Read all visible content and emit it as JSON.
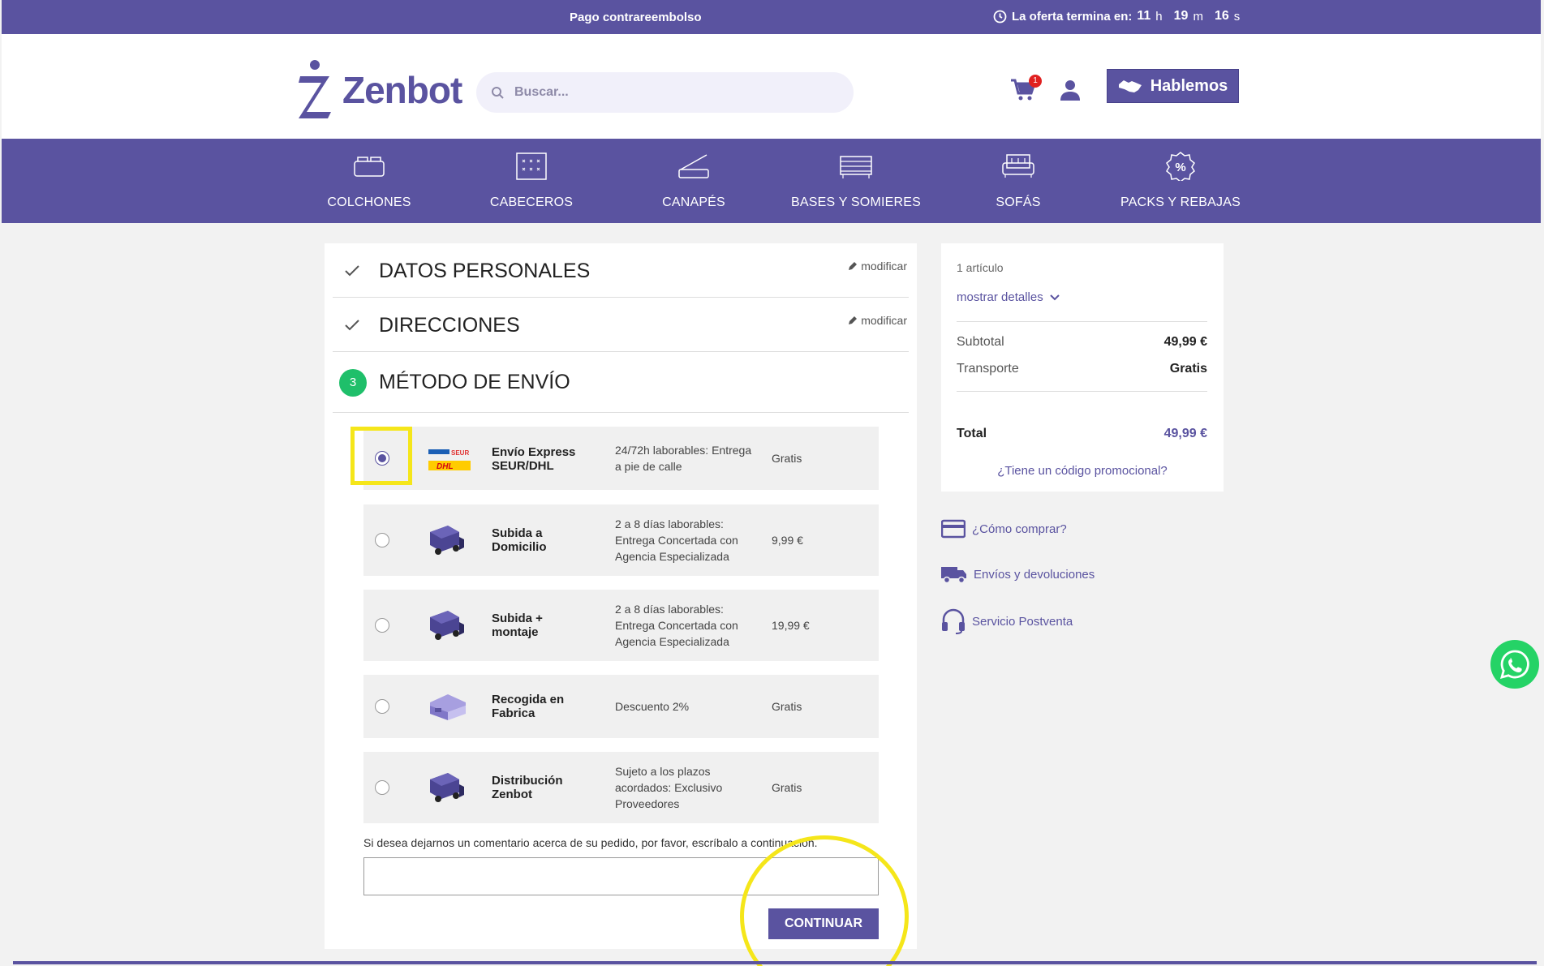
{
  "topbar": {
    "promo": "Pago contrareembolso",
    "offer_label": "La oferta termina en:",
    "hours": "11",
    "hours_unit": "h",
    "minutes": "19",
    "minutes_unit": "m",
    "seconds": "16",
    "seconds_unit": "s"
  },
  "header": {
    "logo_text": "Zenbot",
    "search_placeholder": "Buscar...",
    "cart_count": "1",
    "hablemos_label": "Hablemos"
  },
  "nav": [
    {
      "label": "COLCHONES",
      "icon": "mattress-icon"
    },
    {
      "label": "CABECEROS",
      "icon": "headboard-icon"
    },
    {
      "label": "CANAPÉS",
      "icon": "canape-icon"
    },
    {
      "label": "BASES Y SOMIERES",
      "icon": "bed-base-icon"
    },
    {
      "label": "SOFÁS",
      "icon": "sofa-icon"
    },
    {
      "label": "PACKS Y REBAJAS",
      "icon": "percent-badge-icon"
    }
  ],
  "steps": {
    "personal": {
      "title": "DATOS PERSONALES",
      "modify": "modificar"
    },
    "addresses": {
      "title": "DIRECCIONES",
      "modify": "modificar"
    },
    "shipping": {
      "number": "3",
      "title": "MÉTODO DE ENVÍO"
    }
  },
  "shipping_options": [
    {
      "name": "Envío Express SEUR/DHL",
      "desc": "24/72h laborables: Entrega a pie de calle",
      "price": "Gratis",
      "selected": true,
      "icon": "seur-dhl-logo"
    },
    {
      "name": "Subida a Domicilio",
      "desc": "2 a 8 días laborables: Entrega Concertada con Agencia Especializada",
      "price": "9,99 €",
      "selected": false,
      "icon": "truck-icon"
    },
    {
      "name": "Subida + montaje",
      "desc": "2 a 8 días laborables: Entrega Concertada con Agencia Especializada",
      "price": "19,99 €",
      "selected": false,
      "icon": "truck-icon"
    },
    {
      "name": "Recogida en Fabrica",
      "desc": "Descuento 2%",
      "price": "Gratis",
      "selected": false,
      "icon": "warehouse-icon"
    },
    {
      "name": "Distribución Zenbot",
      "desc": "Sujeto a los plazos acordados: Exclusivo Proveedores",
      "price": "Gratis",
      "selected": false,
      "icon": "truck-icon"
    }
  ],
  "seur_label": "SEUR",
  "dhl_label": "DHL",
  "comment": {
    "label": "Si desea dejarnos un comentario acerca de su pedido, por favor, escríbalo a continuación.",
    "value": ""
  },
  "continue_label": "CONTINUAR",
  "summary": {
    "items": "1 artículo",
    "details": "mostrar detalles",
    "subtotal_label": "Subtotal",
    "subtotal_value": "49,99 €",
    "shipping_label": "Transporte",
    "shipping_value": "Gratis",
    "total_label": "Total",
    "total_value": "49,99 €",
    "promo": "¿Tiene un código promocional?"
  },
  "links": [
    {
      "label": "¿Cómo comprar?",
      "icon": "credit-card-icon"
    },
    {
      "label": "Envíos y devoluciones",
      "icon": "delivery-truck-icon"
    },
    {
      "label": "Servicio Postventa",
      "icon": "headset-icon"
    }
  ],
  "colors": {
    "brand": "#5a53a0",
    "success": "#1fbf6a",
    "highlight": "#f5e61a",
    "whatsapp": "#25d366"
  }
}
